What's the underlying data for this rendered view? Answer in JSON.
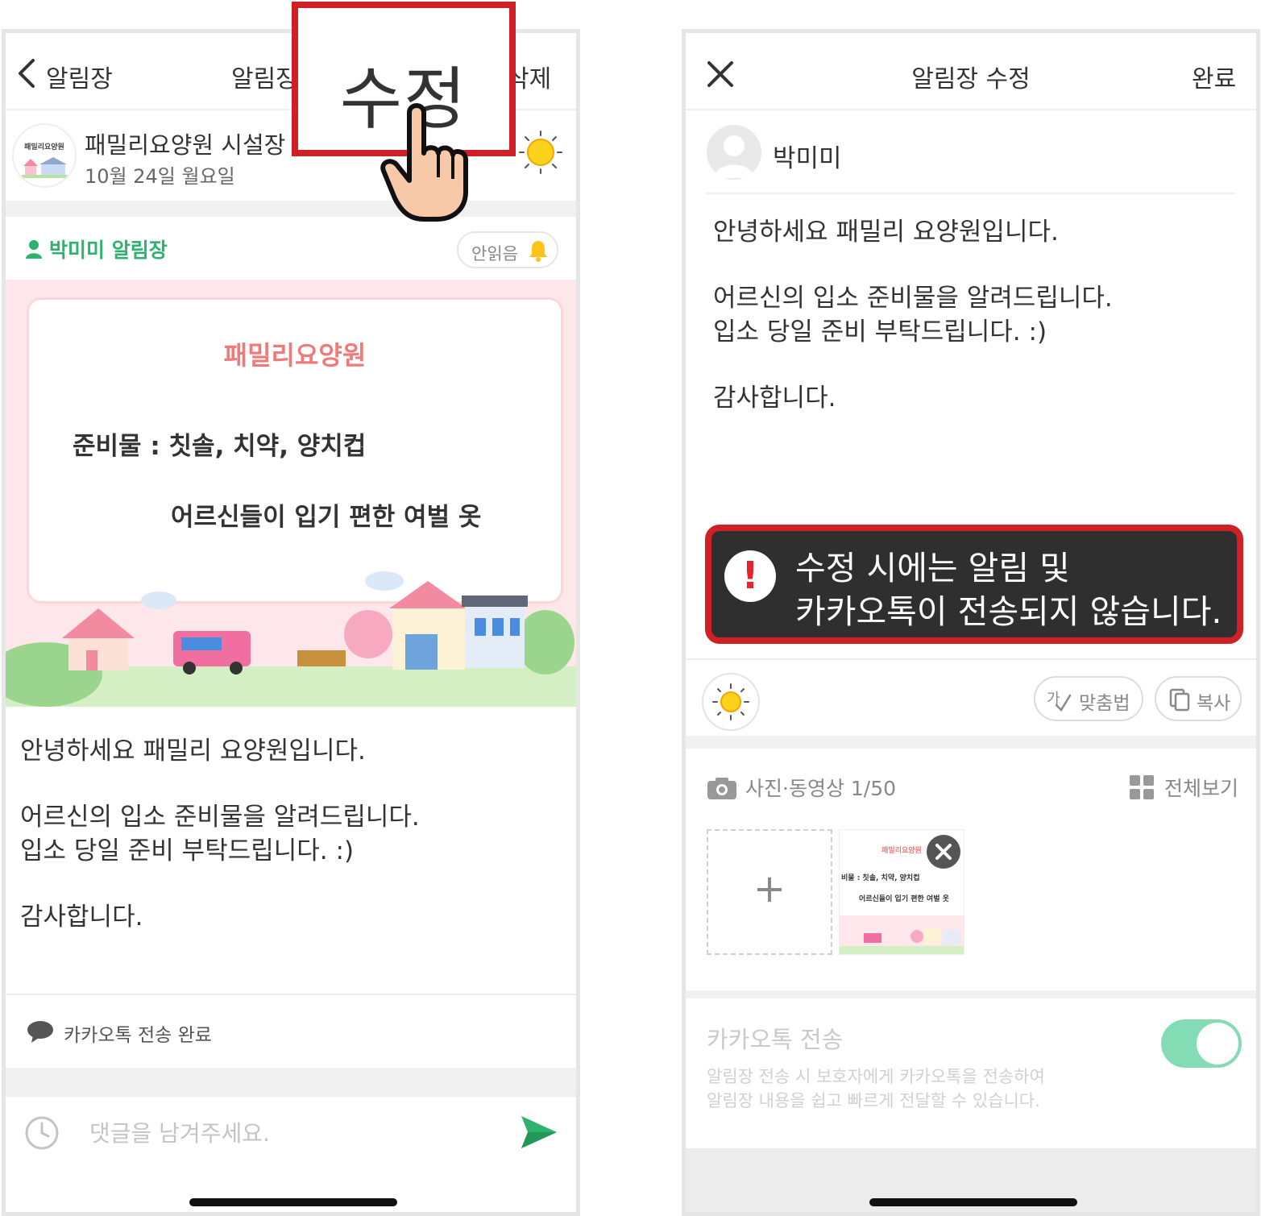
{
  "left_screen": {
    "header": {
      "back_label": "알림장",
      "title": "알림장",
      "delete_label": "삭제",
      "edit_label": "수정"
    },
    "school": {
      "logo_text": "패밀리요양원",
      "name": "패밀리요양원 시설장",
      "date": "10월 24일 월요일"
    },
    "note": {
      "title": "박미미 알림장",
      "unread_label": "안읽음"
    },
    "poster": {
      "title": "패밀리요양원",
      "line1": "준비물 : 칫솔, 치약, 양치컵",
      "line2": "어르신들이 입기 편한 여벌 옷"
    },
    "body": {
      "p1": "안녕하세요 패밀리 요양원입니다.",
      "p2a": "어르신의 입소 준비물을 알려드립니다.",
      "p2b": "입소 당일 준비 부탁드립니다. :)",
      "p3": "감사합니다."
    },
    "kakao_status": "카카오톡 전송 완료",
    "comment_placeholder": "댓글을 남겨주세요."
  },
  "right_screen": {
    "header": {
      "title": "알림장 수정",
      "done_label": "완료"
    },
    "author": "박미미",
    "body": {
      "p1": "안녕하세요 패밀리 요양원입니다.",
      "p2a": "어르신의 입소 준비물을 알려드립니다.",
      "p2b": "입소 당일 준비 부탁드립니다. :)",
      "p3": "감사합니다."
    },
    "warning": {
      "line1": "수정 시에는 알림 및",
      "line2": "카카오톡이 전송되지 않습니다."
    },
    "tools": {
      "spellcheck_label": "맞춤법",
      "copy_label": "복사"
    },
    "media": {
      "label": "사진·동영상 1/50",
      "view_all_label": "전체보기",
      "add_symbol": "+",
      "thumbnail": {
        "title": "패밀리요양원",
        "line1": "비물 : 칫솔, 치약, 양치컵",
        "line2": "어르신들이 입기 편한 여벌 옷"
      }
    },
    "kakao": {
      "title": "카카오톡 전송",
      "desc_line1": "알림장 전송 시 보호자에게 카카오톡을 전송하여",
      "desc_line2": "알림장 내용을 쉽고 빠르게 전달할 수 있습니다.",
      "toggle_on": true
    }
  },
  "colors": {
    "accent_green": "#2db36e",
    "highlight_red": "#d11f26",
    "poster_pink": "#fde7ea",
    "poster_title": "#f07a7a",
    "toggle_green": "#83dcb4",
    "warning_bg": "#2f2f2f"
  }
}
